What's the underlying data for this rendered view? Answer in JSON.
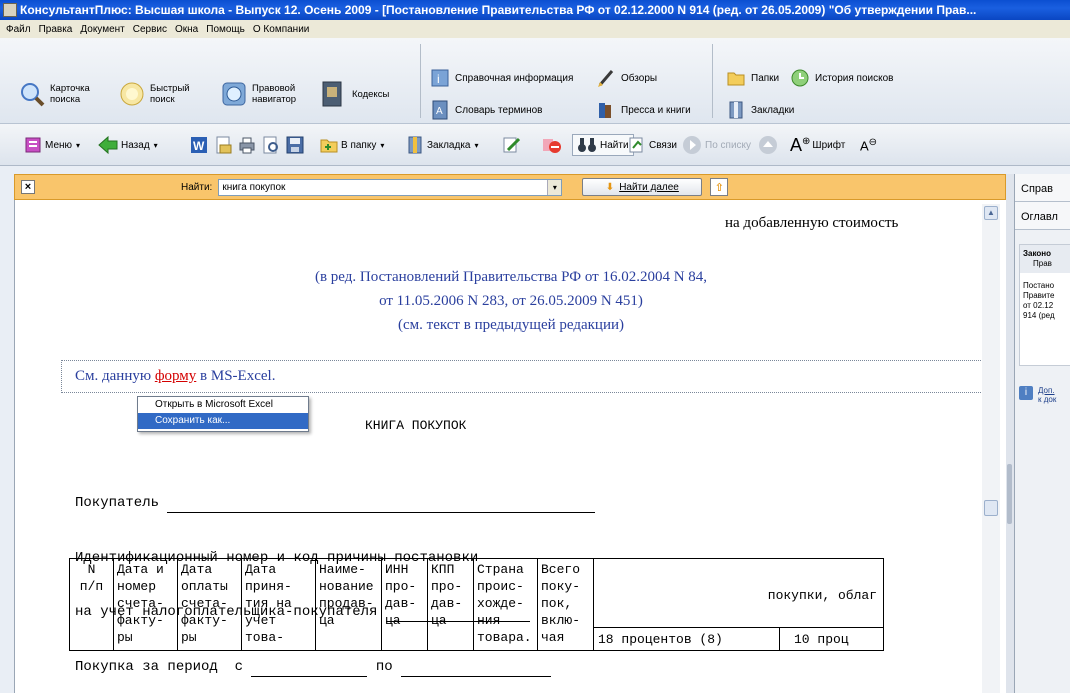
{
  "window": {
    "title": "КонсультантПлюс: Высшая школа - Выпуск 12. Осень 2009 - [Постановление Правительства РФ от 02.12.2000 N 914 (ред. от 26.05.2009) \"Об утверждении Прав..."
  },
  "menu": [
    "Файл",
    "Правка",
    "Документ",
    "Сервис",
    "Окна",
    "Помощь",
    "О Компании"
  ],
  "bigbar": {
    "card_search": [
      "Карточка",
      "поиска"
    ],
    "quick_search": [
      "Быстрый",
      "поиск"
    ],
    "legal_navigator": [
      "Правовой",
      "навигатор"
    ],
    "codes": "Кодексы",
    "reference_info": "Справочная информация",
    "terms_dictionary": "Словарь терминов",
    "reviews": "Обзоры",
    "press_books": "Пресса и книги",
    "folders": "Папки",
    "search_history": "История поисков",
    "bookmarks": "Закладки"
  },
  "toolbar": {
    "menu": "Меню",
    "back": "Назад",
    "to_folder": "В папку",
    "bookmark": "Закладка",
    "find": "Найти",
    "links": "Связи",
    "by_list": "По списку",
    "font": "Шрифт"
  },
  "findbar": {
    "label": "Найти:",
    "value": "книга покупок",
    "find_next": "Найти далее"
  },
  "document": {
    "top_line": "на добавленную стоимость",
    "edition_1": "(в ред. Постановлений Правительства РФ от 16.02.2004 N 84,",
    "edition_2": "от 11.05.2006 N 283, от 26.05.2009 N 451)",
    "edition_3": "(см. текст в предыдущей редакции)",
    "see_prefix": "См. данную ",
    "see_link": "форму",
    "see_suffix": " в MS-Excel.",
    "heading": "КНИГА ПОКУПОК",
    "field_buyer": "Покупатель",
    "field_inn_1": "Идентификационный номер и код причины постановки",
    "field_inn_2": "на учет налогоплательщика-покупателя",
    "field_period": "Покупка за период  с",
    "field_period_to": "по"
  },
  "context_menu": {
    "open_excel": "Открыть в Microsoft Excel",
    "save_as": "Сохранить как..."
  },
  "table": {
    "col1": [
      "N",
      "п/п"
    ],
    "col2": [
      "Дата и",
      "номер",
      "счета-",
      "факту-",
      "ры"
    ],
    "col3": [
      "Дата",
      "оплаты",
      "счета-",
      "факту-",
      "ры"
    ],
    "col4": [
      "Дата",
      "приня-",
      "тия на",
      "учет",
      "това-"
    ],
    "col5": [
      "Наиме-",
      "нование",
      "продав-",
      "ца"
    ],
    "col6": [
      "ИНН",
      "про-",
      "дав-",
      "ца"
    ],
    "col7": [
      "КПП",
      "про-",
      "дав-",
      "ца"
    ],
    "col8": [
      "Страна",
      "проис-",
      "хожде-",
      "ния",
      "товара."
    ],
    "col9": [
      "Всего",
      "поку-",
      "пок,",
      "вклю-",
      "чая"
    ],
    "col10": "покупки, облаг",
    "col11": "18 процентов (8)",
    "col12": "10 проц"
  },
  "right_panel": {
    "tab1": "Справ",
    "tab2": "Оглавл",
    "box_title_1": "Законо",
    "box_title_2": "Прав",
    "box_text": [
      "Постано",
      "Правите",
      "от 02.12",
      "914 (ред"
    ],
    "extra_1": "Доп.",
    "extra_2": "к док"
  },
  "colors": {
    "titlebar": "#0b4fd1",
    "findbar": "#f9c56b",
    "selection": "#316ac5",
    "link_red": "#d40000",
    "text_blue": "#2a3f9e"
  }
}
